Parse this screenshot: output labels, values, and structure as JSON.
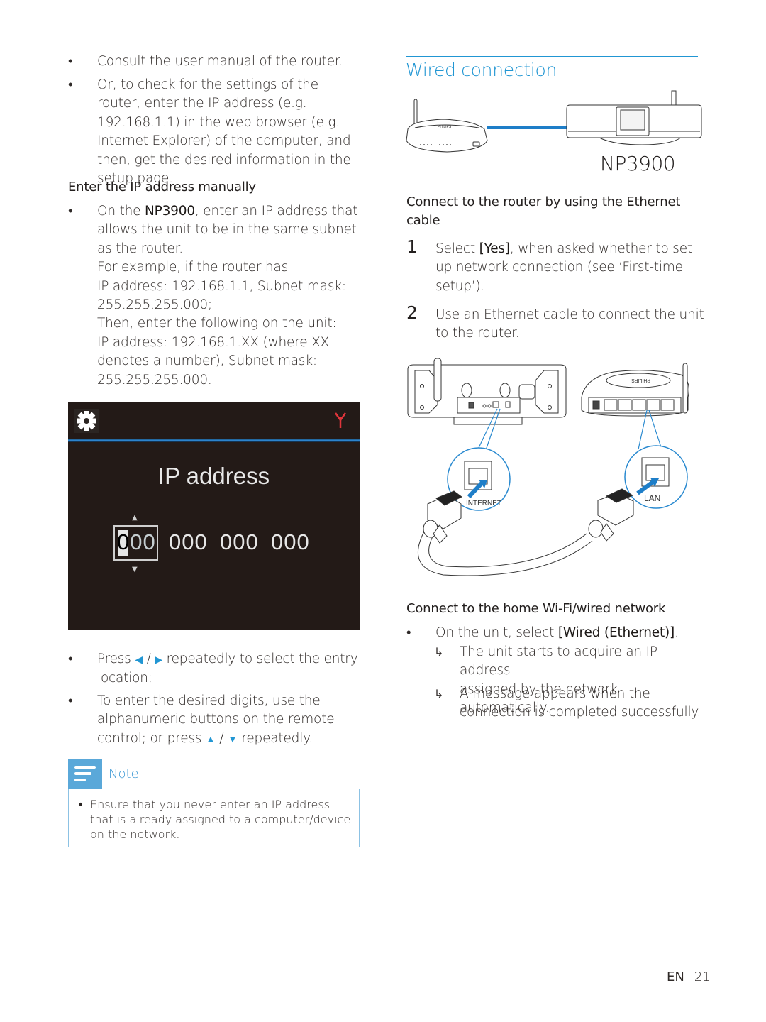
{
  "left_column": {
    "router_tips": [
      "Consult the user manual of the router.",
      "Or, to check for the settings of the router, enter the IP address (e.g. 192.168.1.1) in the web browser (e.g. Internet Explorer) of the computer, and then, get the desired information in the setup page."
    ],
    "manual_heading": "Enter the IP address manually",
    "manual_step": {
      "prefix": "On the ",
      "model": "NP3900",
      "suffix": ", enter an IP address that allows the unit to be in the same subnet as the router.",
      "example_line1": "For example, if the router has",
      "example_line2": "IP address: 192.168.1.1, Subnet mask:",
      "example_line3": "255.255.255.000;",
      "then_line1": "Then, enter the following on the unit:",
      "then_line2": "IP address: 192.168.1.XX (where XX",
      "then_line3": "denotes a number), Subnet mask:",
      "then_line4": "255.255.255.000."
    },
    "device_screen": {
      "title": "IP address",
      "fields": [
        "000",
        "000",
        "000",
        "000"
      ],
      "selected_field_index": 0,
      "icons": [
        "gear-icon",
        "antenna-signal-icon",
        "arrow-up-icon",
        "arrow-down-icon"
      ],
      "divider_color": "#2f8cd6",
      "antenna_color": "#e0353b"
    },
    "press_step": {
      "prefix": "Press ",
      "left_glyph": "◀",
      "sep": " / ",
      "right_glyph": "▶",
      "suffix_line1": " repeatedly to select the entry",
      "suffix_line2": "location;"
    },
    "digits_step": {
      "line1": "To enter the desired digits, use the",
      "line2": "alphanumeric buttons on the remote",
      "line3_prefix": "control; or press ",
      "up_glyph": "▲",
      "sep": " / ",
      "down_glyph": "▼",
      "line3_suffix": " repeatedly."
    },
    "note": {
      "label": "Note",
      "text": "Ensure that you never enter an IP address that is already assigned to a computer/device on the network."
    }
  },
  "right_column": {
    "section_title": "Wired connection",
    "device_label": "NP3900",
    "router_brand": "PHILIPS",
    "ethernet_heading_line1": "Connect to the router by using the Ethernet",
    "ethernet_heading_line2": "cable",
    "steps": [
      {
        "number": "1",
        "prefix": "Select ",
        "bold": "[Yes]",
        "line1_suffix": ", when asked whether to set",
        "line2": "up network connection (see ‘First-time",
        "line3": "setup’)."
      },
      {
        "number": "2",
        "line1": "Use an Ethernet cable to connect the unit",
        "line2": "to the router."
      }
    ],
    "diagram_labels": {
      "internet_port": "INTERNET",
      "lan_port": "LAN"
    },
    "home_network_heading": "Connect to the home Wi-Fi/wired network",
    "home_step": {
      "prefix": "On the unit, select ",
      "bold": "[Wired (Ethernet)]",
      "suffix": "."
    },
    "results": [
      {
        "line1": "The unit starts to acquire an IP address",
        "line2": "assigned by the network automatically."
      },
      {
        "line1": "A message appears when the",
        "line2": "connection is completed successfully."
      }
    ],
    "result_glyph": "↳"
  },
  "footer": {
    "language": "EN",
    "page_number": "21"
  },
  "colors": {
    "accent_blue": "#2196d3",
    "note_tab": "#5aa8d9",
    "screen_bg": "#231a17"
  }
}
